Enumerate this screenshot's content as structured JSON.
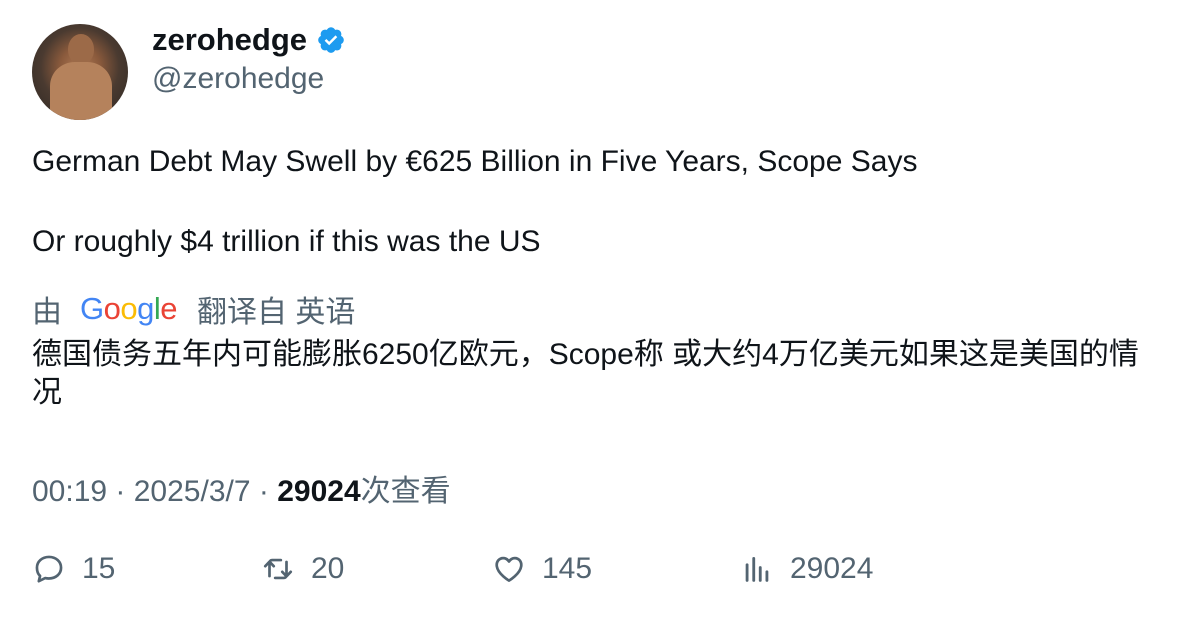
{
  "author": {
    "display_name": "zerohedge",
    "handle": "@zerohedge",
    "verified_color": "#1d9bf0"
  },
  "tweet": {
    "line1": "German Debt May Swell by €625 Billion in Five Years, Scope Says",
    "line2": "Or roughly $4 trillion if this was the US"
  },
  "translation": {
    "prefix": "由",
    "provider": "Google",
    "suffix": "翻译自 英语",
    "text": "德国债务五年内可能膨胀6250亿欧元，Scope称 或大约4万亿美元如果这是美国的情况"
  },
  "meta": {
    "time": "00:19",
    "sep": " · ",
    "date": "2025/3/7",
    "views_count": "29024",
    "views_label": "次查看"
  },
  "actions": {
    "replies": "15",
    "reposts": "20",
    "likes": "145",
    "views": "29024"
  }
}
